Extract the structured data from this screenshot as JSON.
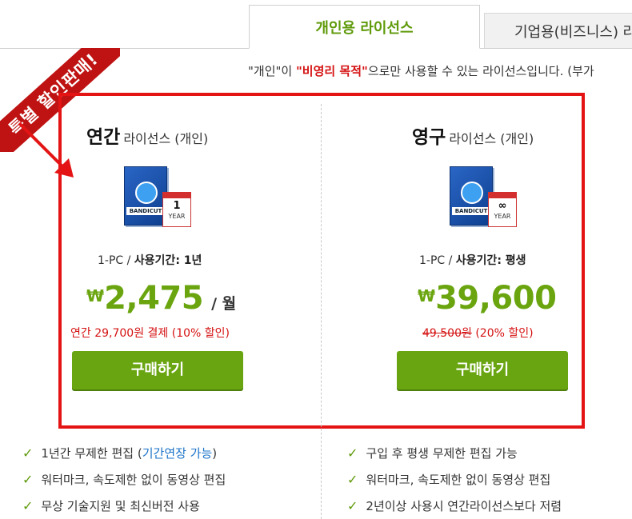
{
  "tabs": [
    {
      "label": "개인용 라이선스"
    },
    {
      "label": "기업용(비즈니스) 라"
    }
  ],
  "notice": {
    "part1": "\"개인\"이 ",
    "highlight": "\"비영리 목적\"",
    "part2": "으로만 사용할 수 있는 라이선스입니다. (부가"
  },
  "ribbon": {
    "label": "특별 할인판매!"
  },
  "plans": [
    {
      "title_main": "연간",
      "title_sub": "라이선스 (개인)",
      "product_brand": "BANDICUT",
      "calendar_number": "1",
      "calendar_unit": "YEAR",
      "spec_prefix": "1-PC / ",
      "spec_bold": "사용기간: 1년",
      "currency": "₩",
      "price": "2,475",
      "unit": "/ 월",
      "discount_plain": "연간 29,700원 결제 (10% 할인)",
      "buy_label": "구매하기"
    },
    {
      "title_main": "영구",
      "title_sub": "라이선스 (개인)",
      "product_brand": "BANDICUT",
      "calendar_number": "∞",
      "calendar_unit": "YEAR",
      "spec_prefix": "1-PC / ",
      "spec_bold": "사용기간: 평생",
      "currency": "₩",
      "price": "39,600",
      "original_price": "49,500원",
      "discount_rest": " (20% 할인)",
      "buy_label": "구매하기"
    }
  ],
  "features_left": [
    {
      "text": "1년간 무제한 편집 (",
      "link": "기간연장 가능",
      "after": ")"
    },
    {
      "text": "워터마크, 속도제한 없이 동영상 편집"
    },
    {
      "text": "무상 기술지원 및 최신버전 사용"
    }
  ],
  "features_right": [
    {
      "text": "구입 후 평생 무제한 편집 가능"
    },
    {
      "text": "워터마크, 속도제한 없이 동영상 편집"
    },
    {
      "text": "2년이상 사용시 연간라이선스보다 저렴"
    }
  ],
  "colors": {
    "accent_green": "#69a511",
    "sale_red": "#e41414"
  },
  "icons": {
    "check": "check-icon",
    "arrow": "arrow-icon"
  }
}
